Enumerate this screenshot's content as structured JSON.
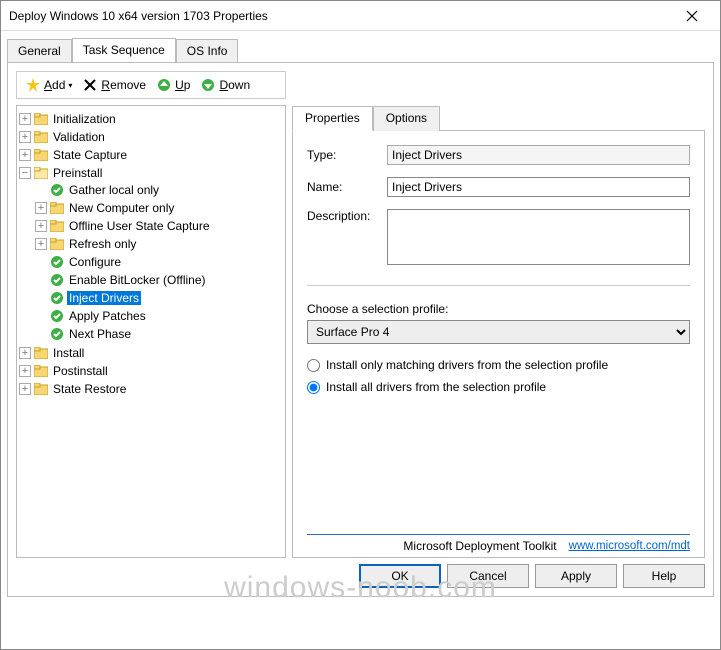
{
  "window": {
    "title": "Deploy Windows 10 x64 version 1703 Properties"
  },
  "main_tabs": {
    "general": "General",
    "task_sequence": "Task Sequence",
    "os_info": "OS Info"
  },
  "toolbar": {
    "add": "Add",
    "remove": "Remove",
    "up": "Up",
    "down": "Down"
  },
  "tree": {
    "initialization": "Initialization",
    "validation": "Validation",
    "state_capture": "State Capture",
    "preinstall": "Preinstall",
    "gather_local_only": "Gather local only",
    "new_computer_only": "New Computer only",
    "offline_user_state_capture": "Offline User State Capture",
    "refresh_only": "Refresh only",
    "configure": "Configure",
    "enable_bitlocker": "Enable BitLocker (Offline)",
    "inject_drivers": "Inject Drivers",
    "apply_patches": "Apply Patches",
    "next_phase": "Next Phase",
    "install": "Install",
    "postinstall": "Postinstall",
    "state_restore": "State Restore"
  },
  "inner_tabs": {
    "properties": "Properties",
    "options": "Options"
  },
  "form": {
    "type_label": "Type:",
    "type_value": "Inject Drivers",
    "name_label": "Name:",
    "name_value": "Inject Drivers",
    "description_label": "Description:",
    "description_value": "",
    "selection_profile_label": "Choose a selection profile:",
    "selection_profile_value": "Surface Pro 4",
    "radio_matching": "Install only matching drivers from the selection profile",
    "radio_all": "Install all drivers from the selection profile"
  },
  "footer": {
    "brand": "Microsoft Deployment Toolkit",
    "link_text": "www.microsoft.com/mdt"
  },
  "buttons": {
    "ok": "OK",
    "cancel": "Cancel",
    "apply": "Apply",
    "help": "Help"
  },
  "watermark": "windows-noob.com"
}
